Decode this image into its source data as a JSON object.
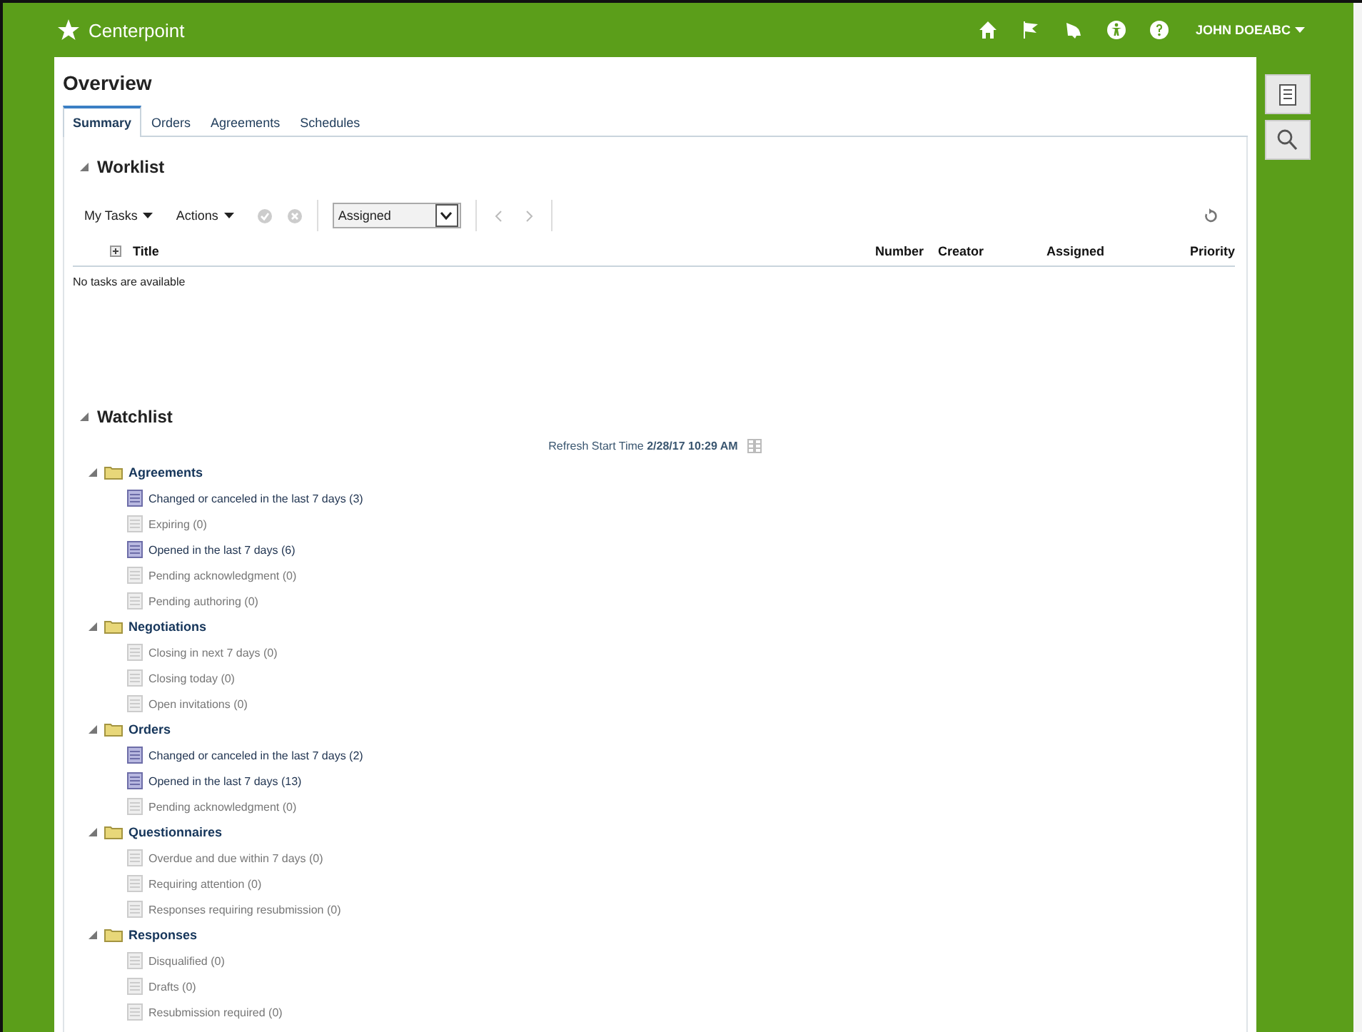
{
  "header": {
    "app_name": "Centerpoint",
    "user": "JOHN DOEABC"
  },
  "page": {
    "title": "Overview"
  },
  "tabs": [
    {
      "label": "Summary",
      "selected": true
    },
    {
      "label": "Orders",
      "selected": false
    },
    {
      "label": "Agreements",
      "selected": false
    },
    {
      "label": "Schedules",
      "selected": false
    }
  ],
  "worklist": {
    "title": "Worklist",
    "expanded": true,
    "toolbar": {
      "menus": [
        "My Tasks",
        "Actions"
      ],
      "filter": {
        "value": "Assigned"
      }
    },
    "columns": [
      "Title",
      "Number",
      "Creator",
      "Assigned",
      "Priority"
    ],
    "empty_message": "No tasks are available"
  },
  "watchlist": {
    "title": "Watchlist",
    "expanded": true,
    "refresh": "Refresh Start Time **2/28/17 10:29 AM**",
    "folders": [
      {
        "label": "Agreements",
        "expanded": true,
        "children": [
          {
            "label": "Changed or canceled in the last 7 days (3)",
            "active": true
          },
          {
            "label": "Expiring (0)",
            "active": false
          },
          {
            "label": "Opened in the last 7 days (6)",
            "active": true
          },
          {
            "label": "Pending acknowledgment (0)",
            "active": false
          },
          {
            "label": "Pending authoring (0)",
            "active": false
          }
        ]
      },
      {
        "label": "Negotiations",
        "expanded": true,
        "children": [
          {
            "label": "Closing in next 7 days (0)",
            "active": false
          },
          {
            "label": "Closing today (0)",
            "active": false
          },
          {
            "label": "Open invitations (0)",
            "active": false
          }
        ]
      },
      {
        "label": "Orders",
        "expanded": true,
        "children": [
          {
            "label": "Changed or canceled in the last 7 days (2)",
            "active": true
          },
          {
            "label": "Opened in the last 7 days (13)",
            "active": true
          },
          {
            "label": "Pending acknowledgment (0)",
            "active": false
          }
        ]
      },
      {
        "label": "Questionnaires",
        "expanded": true,
        "children": [
          {
            "label": "Overdue and due within 7 days (0)",
            "active": false
          },
          {
            "label": "Requiring attention (0)",
            "active": false
          },
          {
            "label": "Responses requiring resubmission (0)",
            "active": false
          }
        ]
      },
      {
        "label": "Responses",
        "expanded": true,
        "children": [
          {
            "label": "Disqualified (0)",
            "active": false
          },
          {
            "label": "Drafts (0)",
            "active": false
          },
          {
            "label": "Resubmission required (0)",
            "active": false
          }
        ]
      }
    ]
  }
}
